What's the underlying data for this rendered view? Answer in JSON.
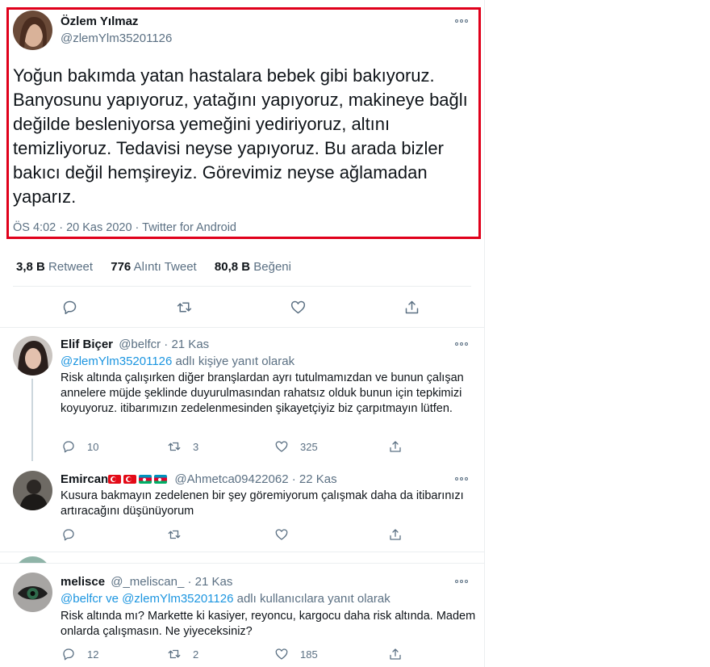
{
  "main_tweet": {
    "author_name": "Özlem Yılmaz",
    "author_handle": "@zlemYlm35201126",
    "text": "Yoğun bakımda yatan hastalara bebek gibi bakıyoruz. Banyosunu yapıyoruz, yatağını yapıyoruz, makineye bağlı değilde besleniyorsa yemeğini yediriyoruz, altını temizliyoruz. Tedavisi neyse yapıyoruz. Bu arada bizler bakıcı değil hemşireyiz. Görevimiz neyse ağlamadan yaparız.",
    "meta": "ÖS 4:02 · 20 Kas 2020 · Twitter for Android",
    "stats": {
      "retweet_count": "3,8 B",
      "retweet_label": "Retweet",
      "quote_count": "776",
      "quote_label": "Alıntı Tweet",
      "like_count": "80,8 B",
      "like_label": "Beğeni"
    },
    "highlight_color": "#e0001b"
  },
  "replies": [
    {
      "name": "Elif Biçer",
      "handle": "@belfcr",
      "date": "· 21 Kas",
      "replying_handles": "@zlemYlm35201126",
      "replying_suffix": "adlı kişiye yanıt olarak",
      "text": "Risk altında çalışırken diğer branşlardan ayrı tutulmamızdan ve bunun çalışan annelere müjde şeklinde duyurulmasından rahatsız olduk bunun için tepkimizi koyuyoruz. itibarımızın zedelenmesinden şikayetçiyiz biz çarpıtmayın lütfen.",
      "replies": "10",
      "retweets": "3",
      "likes": "325"
    },
    {
      "name": "Emircan",
      "handle": "@Ahmetca09422062",
      "date": "· 22 Kas",
      "name_flags": [
        "tr-flag",
        "tr-flag",
        "az-flag",
        "az-flag"
      ],
      "text": "Kusura bakmayın zedelenen bir şey göremiyorum çalışmak daha da itibarınızı artıracağını düşünüyorum",
      "replies": "",
      "retweets": "",
      "likes": ""
    },
    {
      "name": "melisce",
      "handle": "@_meliscan_",
      "date": "· 21 Kas",
      "replying_handles": "@belfcr ve @zlemYlm35201126",
      "replying_suffix": "adlı kullanıcılara yanıt olarak",
      "text": "Risk altında mı? Markette ki kasiyer, reyoncu, kargocu daha risk altında. Madem onlarda çalışmasın. Ne yiyeceksiniz?",
      "replies": "12",
      "retweets": "2",
      "likes": "185"
    }
  ],
  "colors": {
    "link": "#1b95e0",
    "muted": "#5b7083",
    "divider": "#ebeef0"
  }
}
